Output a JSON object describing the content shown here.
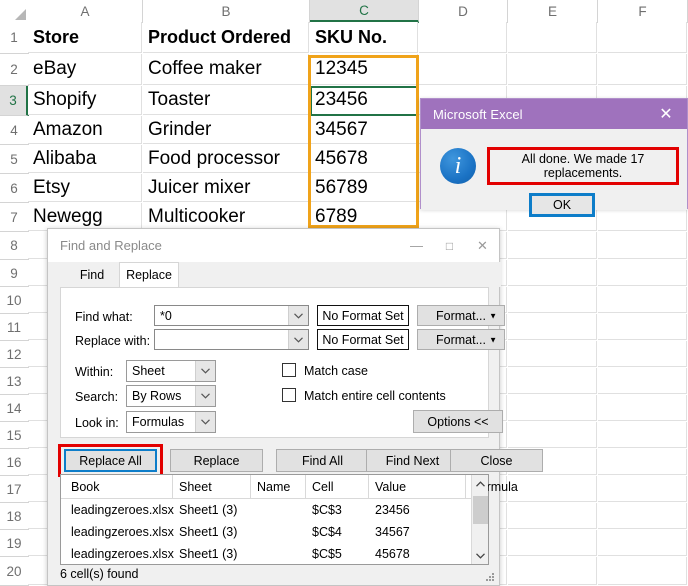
{
  "spreadsheet": {
    "column_headers": [
      "A",
      "B",
      "C",
      "D",
      "E",
      "F"
    ],
    "row_headers": [
      "1",
      "2",
      "3",
      "4",
      "5",
      "6",
      "7",
      "8",
      "9",
      "10",
      "11",
      "12",
      "13",
      "14",
      "15",
      "16",
      "17",
      "18",
      "19",
      "20"
    ],
    "selected_column": "C",
    "selected_row": "3",
    "active_cell": "C3",
    "columns": {
      "A": [
        "Store",
        "eBay",
        "Shopify",
        "Amazon",
        "Alibaba",
        "Etsy",
        "Newegg"
      ],
      "B": [
        "Product Ordered",
        "Coffee maker",
        "Toaster",
        "Grinder",
        "Food processor",
        "Juicer mixer",
        "Multicooker"
      ],
      "C": [
        "SKU No.",
        "12345",
        "23456",
        "34567",
        "45678",
        "56789",
        "6789"
      ]
    },
    "highlight_color": "#f0a31a",
    "selection_color": "#217346"
  },
  "message_box": {
    "title": "Microsoft Excel",
    "close_icon": "close-icon",
    "info_icon": "i",
    "message": "All done. We made 17 replacements.",
    "ok_label": "OK",
    "title_bar_color": "#9f72bd",
    "message_outline_color": "#e20000",
    "ok_outline_color": "#0d7dc9"
  },
  "find_replace": {
    "title": "Find and Replace",
    "window_buttons": {
      "minimize": "—",
      "maximize": "□",
      "close": "✕"
    },
    "tabs": [
      {
        "label": "Find",
        "active": false
      },
      {
        "label": "Replace",
        "active": true
      }
    ],
    "fields": {
      "find_what_label": "Find what:",
      "find_what_value": "*0",
      "replace_with_label": "Replace with:",
      "replace_with_value": "",
      "find_format_status": "No Format Set",
      "replace_format_status": "No Format Set",
      "find_format_button": "Format...",
      "replace_format_button": "Format..."
    },
    "options": {
      "within_label": "Within:",
      "within_value": "Sheet",
      "search_label": "Search:",
      "search_value": "By Rows",
      "look_in_label": "Look in:",
      "look_in_value": "Formulas",
      "match_case_label": "Match case",
      "match_case_checked": false,
      "match_entire_label": "Match entire cell contents",
      "match_entire_checked": false,
      "options_button": "Options <<"
    },
    "buttons": [
      {
        "label": "Replace All",
        "highlighted": true
      },
      {
        "label": "Replace",
        "highlighted": false
      },
      {
        "label": "Find All",
        "highlighted": false
      },
      {
        "label": "Find Next",
        "highlighted": false
      },
      {
        "label": "Close",
        "highlighted": false
      }
    ],
    "results": {
      "headers": [
        "Book",
        "Sheet",
        "Name",
        "Cell",
        "Value",
        "Formula"
      ],
      "rows": [
        {
          "book": "leadingzeroes.xlsx",
          "sheet": "Sheet1 (3)",
          "name": "",
          "cell": "$C$3",
          "value": "23456",
          "formula": ""
        },
        {
          "book": "leadingzeroes.xlsx",
          "sheet": "Sheet1 (3)",
          "name": "",
          "cell": "$C$4",
          "value": "34567",
          "formula": ""
        },
        {
          "book": "leadingzeroes.xlsx",
          "sheet": "Sheet1 (3)",
          "name": "",
          "cell": "$C$5",
          "value": "45678",
          "formula": ""
        }
      ],
      "status": "6 cell(s) found",
      "scroll_up_icon": "chevron-up-icon",
      "scroll_down_icon": "chevron-down-icon"
    }
  }
}
